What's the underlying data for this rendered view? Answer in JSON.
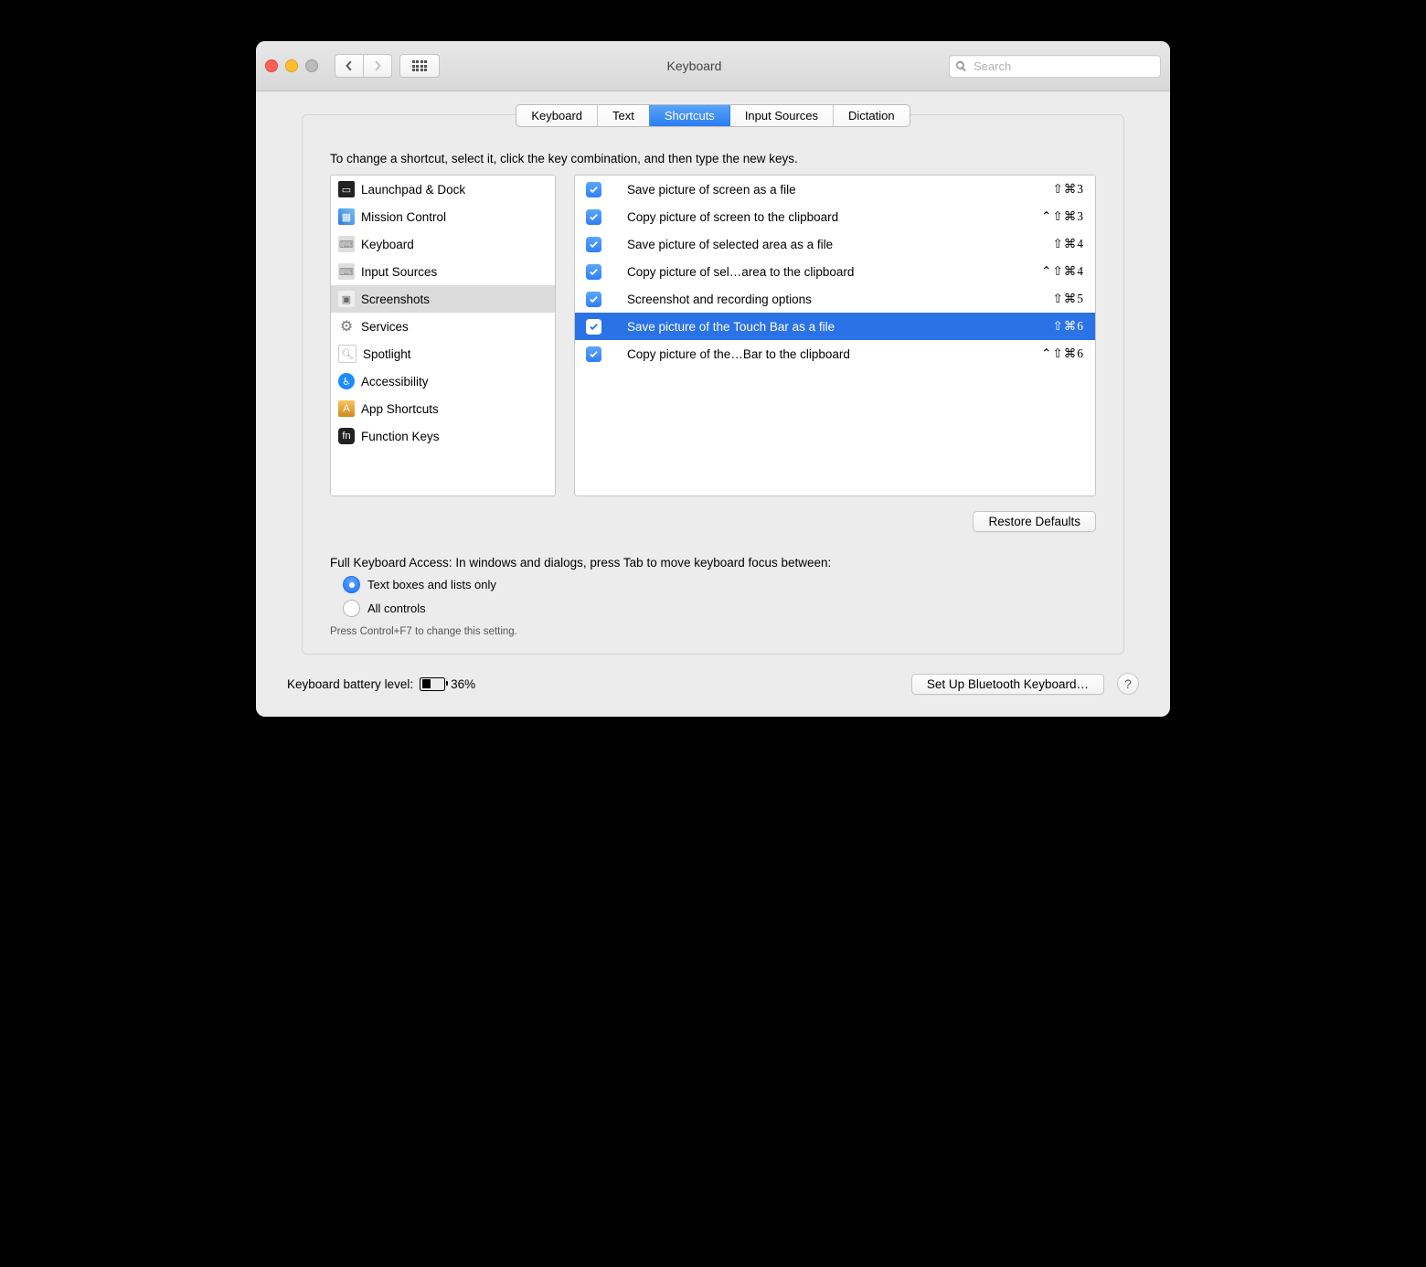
{
  "toolbar": {
    "title": "Keyboard"
  },
  "search": {
    "placeholder": "Search"
  },
  "tabs": [
    {
      "label": "Keyboard",
      "active": false
    },
    {
      "label": "Text",
      "active": false
    },
    {
      "label": "Shortcuts",
      "active": true
    },
    {
      "label": "Input Sources",
      "active": false
    },
    {
      "label": "Dictation",
      "active": false
    }
  ],
  "instruction": "To change a shortcut, select it, click the key combination, and then type the new keys.",
  "categories": [
    {
      "label": "Launchpad & Dock",
      "icon": "dock"
    },
    {
      "label": "Mission Control",
      "icon": "mission"
    },
    {
      "label": "Keyboard",
      "icon": "keyboard"
    },
    {
      "label": "Input Sources",
      "icon": "input"
    },
    {
      "label": "Screenshots",
      "icon": "screenshot",
      "selected": true
    },
    {
      "label": "Services",
      "icon": "gear"
    },
    {
      "label": "Spotlight",
      "icon": "spotlight"
    },
    {
      "label": "Accessibility",
      "icon": "accessibility"
    },
    {
      "label": "App Shortcuts",
      "icon": "app"
    },
    {
      "label": "Function Keys",
      "icon": "fn"
    }
  ],
  "shortcuts": [
    {
      "label": "Save picture of screen as a file",
      "keys": "⇧⌘3",
      "checked": true
    },
    {
      "label": "Copy picture of screen to the clipboard",
      "keys": "⌃⇧⌘3",
      "checked": true
    },
    {
      "label": "Save picture of selected area as a file",
      "keys": "⇧⌘4",
      "checked": true
    },
    {
      "label": "Copy picture of sel…area to the clipboard",
      "keys": "⌃⇧⌘4",
      "checked": true
    },
    {
      "label": "Screenshot and recording options",
      "keys": "⇧⌘5",
      "checked": true
    },
    {
      "label": "Save picture of the Touch Bar as a file",
      "keys": "⇧⌘6",
      "checked": true,
      "selected": true
    },
    {
      "label": "Copy picture of the…Bar to the clipboard",
      "keys": "⌃⇧⌘6",
      "checked": true
    }
  ],
  "restore_label": "Restore Defaults",
  "fka": {
    "label": "Full Keyboard Access: In windows and dialogs, press Tab to move keyboard focus between:",
    "opt1": "Text boxes and lists only",
    "opt2": "All controls",
    "hint": "Press Control+F7 to change this setting."
  },
  "footer": {
    "battery_label": "Keyboard battery level:",
    "battery_pct": "36%",
    "setup_label": "Set Up Bluetooth Keyboard…"
  }
}
